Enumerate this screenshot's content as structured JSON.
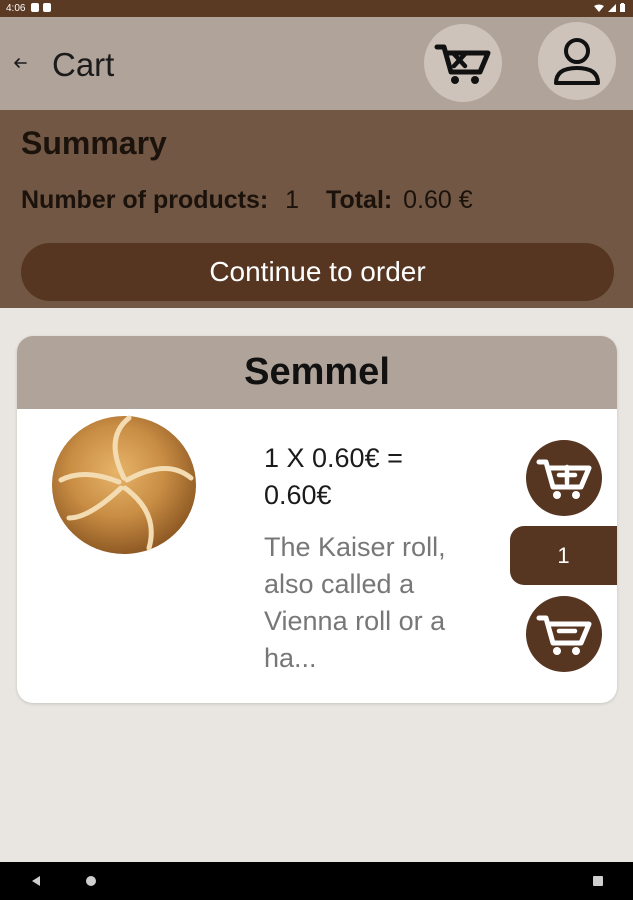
{
  "status_bar": {
    "time": "4:06"
  },
  "app_bar": {
    "title": "Cart",
    "back_icon": "back-arrow-icon",
    "clear_cart_icon": "cart-x-icon",
    "profile_icon": "person-icon"
  },
  "summary": {
    "title": "Summary",
    "products_label": "Number of products:",
    "products_count": "1",
    "total_label": "Total:",
    "total_value": "0.60 €",
    "continue_label": "Continue to order"
  },
  "items": [
    {
      "name": "Semmel",
      "price_line": "1 X 0.60€ = 0.60€",
      "description": "The Kaiser roll, also called a Vienna roll or a ha...",
      "quantity": "1",
      "add_icon": "cart-plus-icon",
      "remove_icon": "cart-minus-icon"
    }
  ],
  "colors": {
    "status_bar": "#5a3a23",
    "app_bar": "#b0a39a",
    "summary_bg": "#715744",
    "accent_dark": "#563621",
    "page_bg": "#e9e6e2"
  }
}
